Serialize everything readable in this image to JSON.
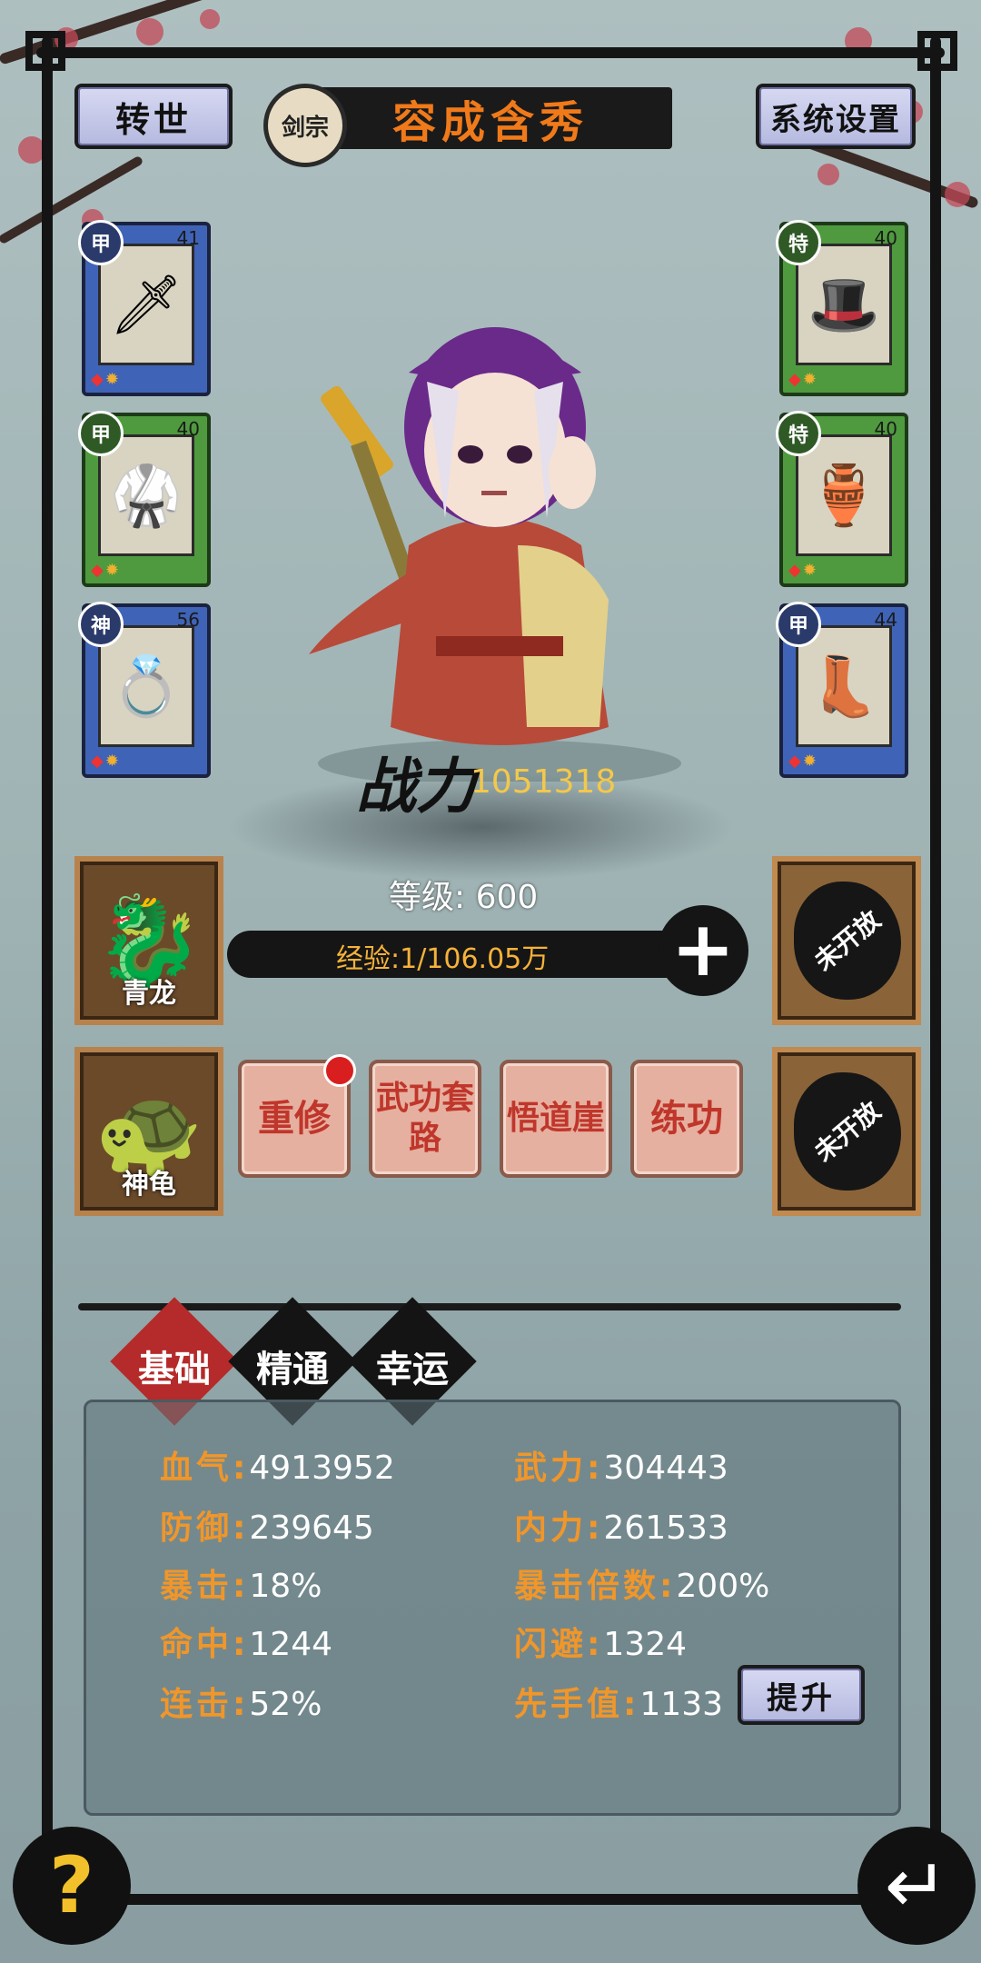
{
  "top": {
    "rebirth_label": "转世",
    "sect_label": "剑宗",
    "character_name": "容成含秀",
    "settings_label": "系统设置"
  },
  "equipment": {
    "left": [
      {
        "tag": "甲",
        "level": "41",
        "icon": "sword-icon"
      },
      {
        "tag": "甲",
        "level": "40",
        "icon": "armor-icon"
      },
      {
        "tag": "神",
        "level": "56",
        "icon": "ring-icon"
      }
    ],
    "right": [
      {
        "tag": "特",
        "level": "40",
        "icon": "hat-icon"
      },
      {
        "tag": "特",
        "level": "40",
        "icon": "gourd-icon"
      },
      {
        "tag": "甲",
        "level": "44",
        "icon": "boots-icon"
      }
    ]
  },
  "power": {
    "label": "战力",
    "value": "1051318"
  },
  "level": {
    "text": "等级: 600",
    "exp_text": "经验:1/106.05万"
  },
  "pets": [
    {
      "name": "青龙",
      "icon": "dragon-icon"
    },
    {
      "name": "神龟",
      "icon": "turtle-icon"
    }
  ],
  "locked_slots": [
    "未开放",
    "未开放"
  ],
  "actions": [
    "重修",
    "武功套路",
    "悟道崖",
    "练功"
  ],
  "tabs": [
    "基础",
    "精通",
    "幸运"
  ],
  "stats": {
    "left": [
      {
        "key": "血气:",
        "value": "4913952"
      },
      {
        "key": "防御:",
        "value": "239645"
      },
      {
        "key": "暴击:",
        "value": "18%"
      },
      {
        "key": "命中:",
        "value": "1244"
      },
      {
        "key": "连击:",
        "value": "52%"
      }
    ],
    "right": [
      {
        "key": "武力:",
        "value": "304443"
      },
      {
        "key": "内力:",
        "value": "261533"
      },
      {
        "key": "暴击倍数:",
        "value": "200%"
      },
      {
        "key": "闪避:",
        "value": "1324"
      },
      {
        "key": "先手值:",
        "value": "1133"
      }
    ],
    "upgrade_label": "提升"
  },
  "help_icon": "?",
  "back_icon": "↵",
  "colors": {
    "accent_orange": "#f0962a",
    "name_orange": "#f07a1a",
    "power_gold": "#f4c84a"
  }
}
